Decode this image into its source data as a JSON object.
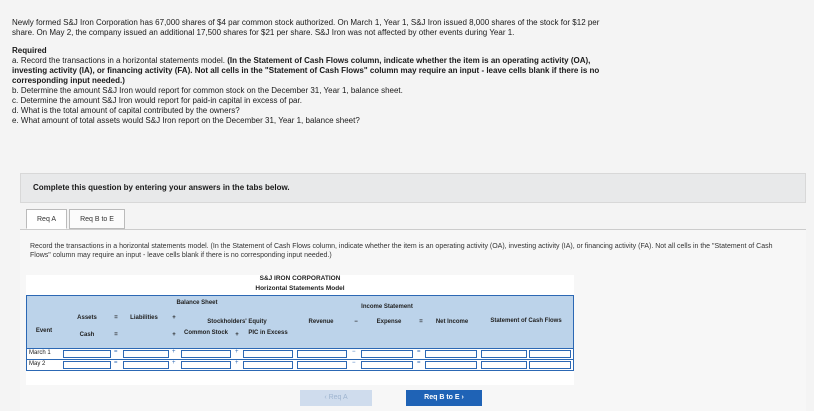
{
  "problem": {
    "intro": "Newly formed S&J Iron Corporation has 67,000 shares of $4 par common stock authorized. On March 1, Year 1, S&J Iron issued 8,000 shares of the stock for $12 per share. On May 2, the company issued an additional 17,500 shares for $21 per share. S&J Iron was not affected by other events during Year 1.",
    "required_label": "Required",
    "a_prefix": "a. Record the transactions in a horizontal statements model.",
    "a_bold": "(In the Statement of Cash Flows column, indicate whether the item is an operating activity (OA), investing activity (IA), or financing activity (FA). Not all cells in the \"Statement of Cash Flows\" column may require an input - leave cells blank if there is no corresponding input needed.)",
    "b": "b. Determine the amount S&J Iron would report for common stock on the December 31, Year 1, balance sheet.",
    "c": "c. Determine the amount S&J Iron would report for paid-in capital in excess of par.",
    "d": "d. What is the total amount of capital contributed by the owners?",
    "e": "e. What amount of total assets would S&J Iron report on the December 31, Year 1, balance sheet?"
  },
  "panel": {
    "text": "Complete this question by entering your answers in the tabs below."
  },
  "tabs": [
    {
      "label": "Req A"
    },
    {
      "label": "Req B to E"
    }
  ],
  "instructions": "Record the transactions in a horizontal statements model. (In the Statement of Cash Flows column, indicate whether the item is an operating activity (OA), investing activity (IA), or financing activity (FA). Not all cells in the \"Statement of Cash Flows\" column may require an input - leave cells blank if there is no corresponding input needed.)",
  "table": {
    "company": "S&J IRON CORPORATION",
    "model": "Horizontal Statements Model",
    "balance_sheet": "Balance Sheet",
    "income_statement": "Income Statement",
    "event": "Event",
    "assets": "Assets",
    "cash": "Cash",
    "eq": "=",
    "liabilities": "Liabilities",
    "plus": "+",
    "stockholders_equity": "Stockholders' Equity",
    "common_stock": "Common Stock",
    "pic": "PIC in Excess",
    "revenue": "Revenue",
    "minus": "−",
    "expense": "Expense",
    "net_income": "Net Income",
    "scf": "Statement of Cash Flows",
    "rows": [
      {
        "event": "March 1"
      },
      {
        "event": "May 2"
      }
    ]
  },
  "nav": {
    "prev": "‹ Req A",
    "next": "Req B to E ›"
  }
}
